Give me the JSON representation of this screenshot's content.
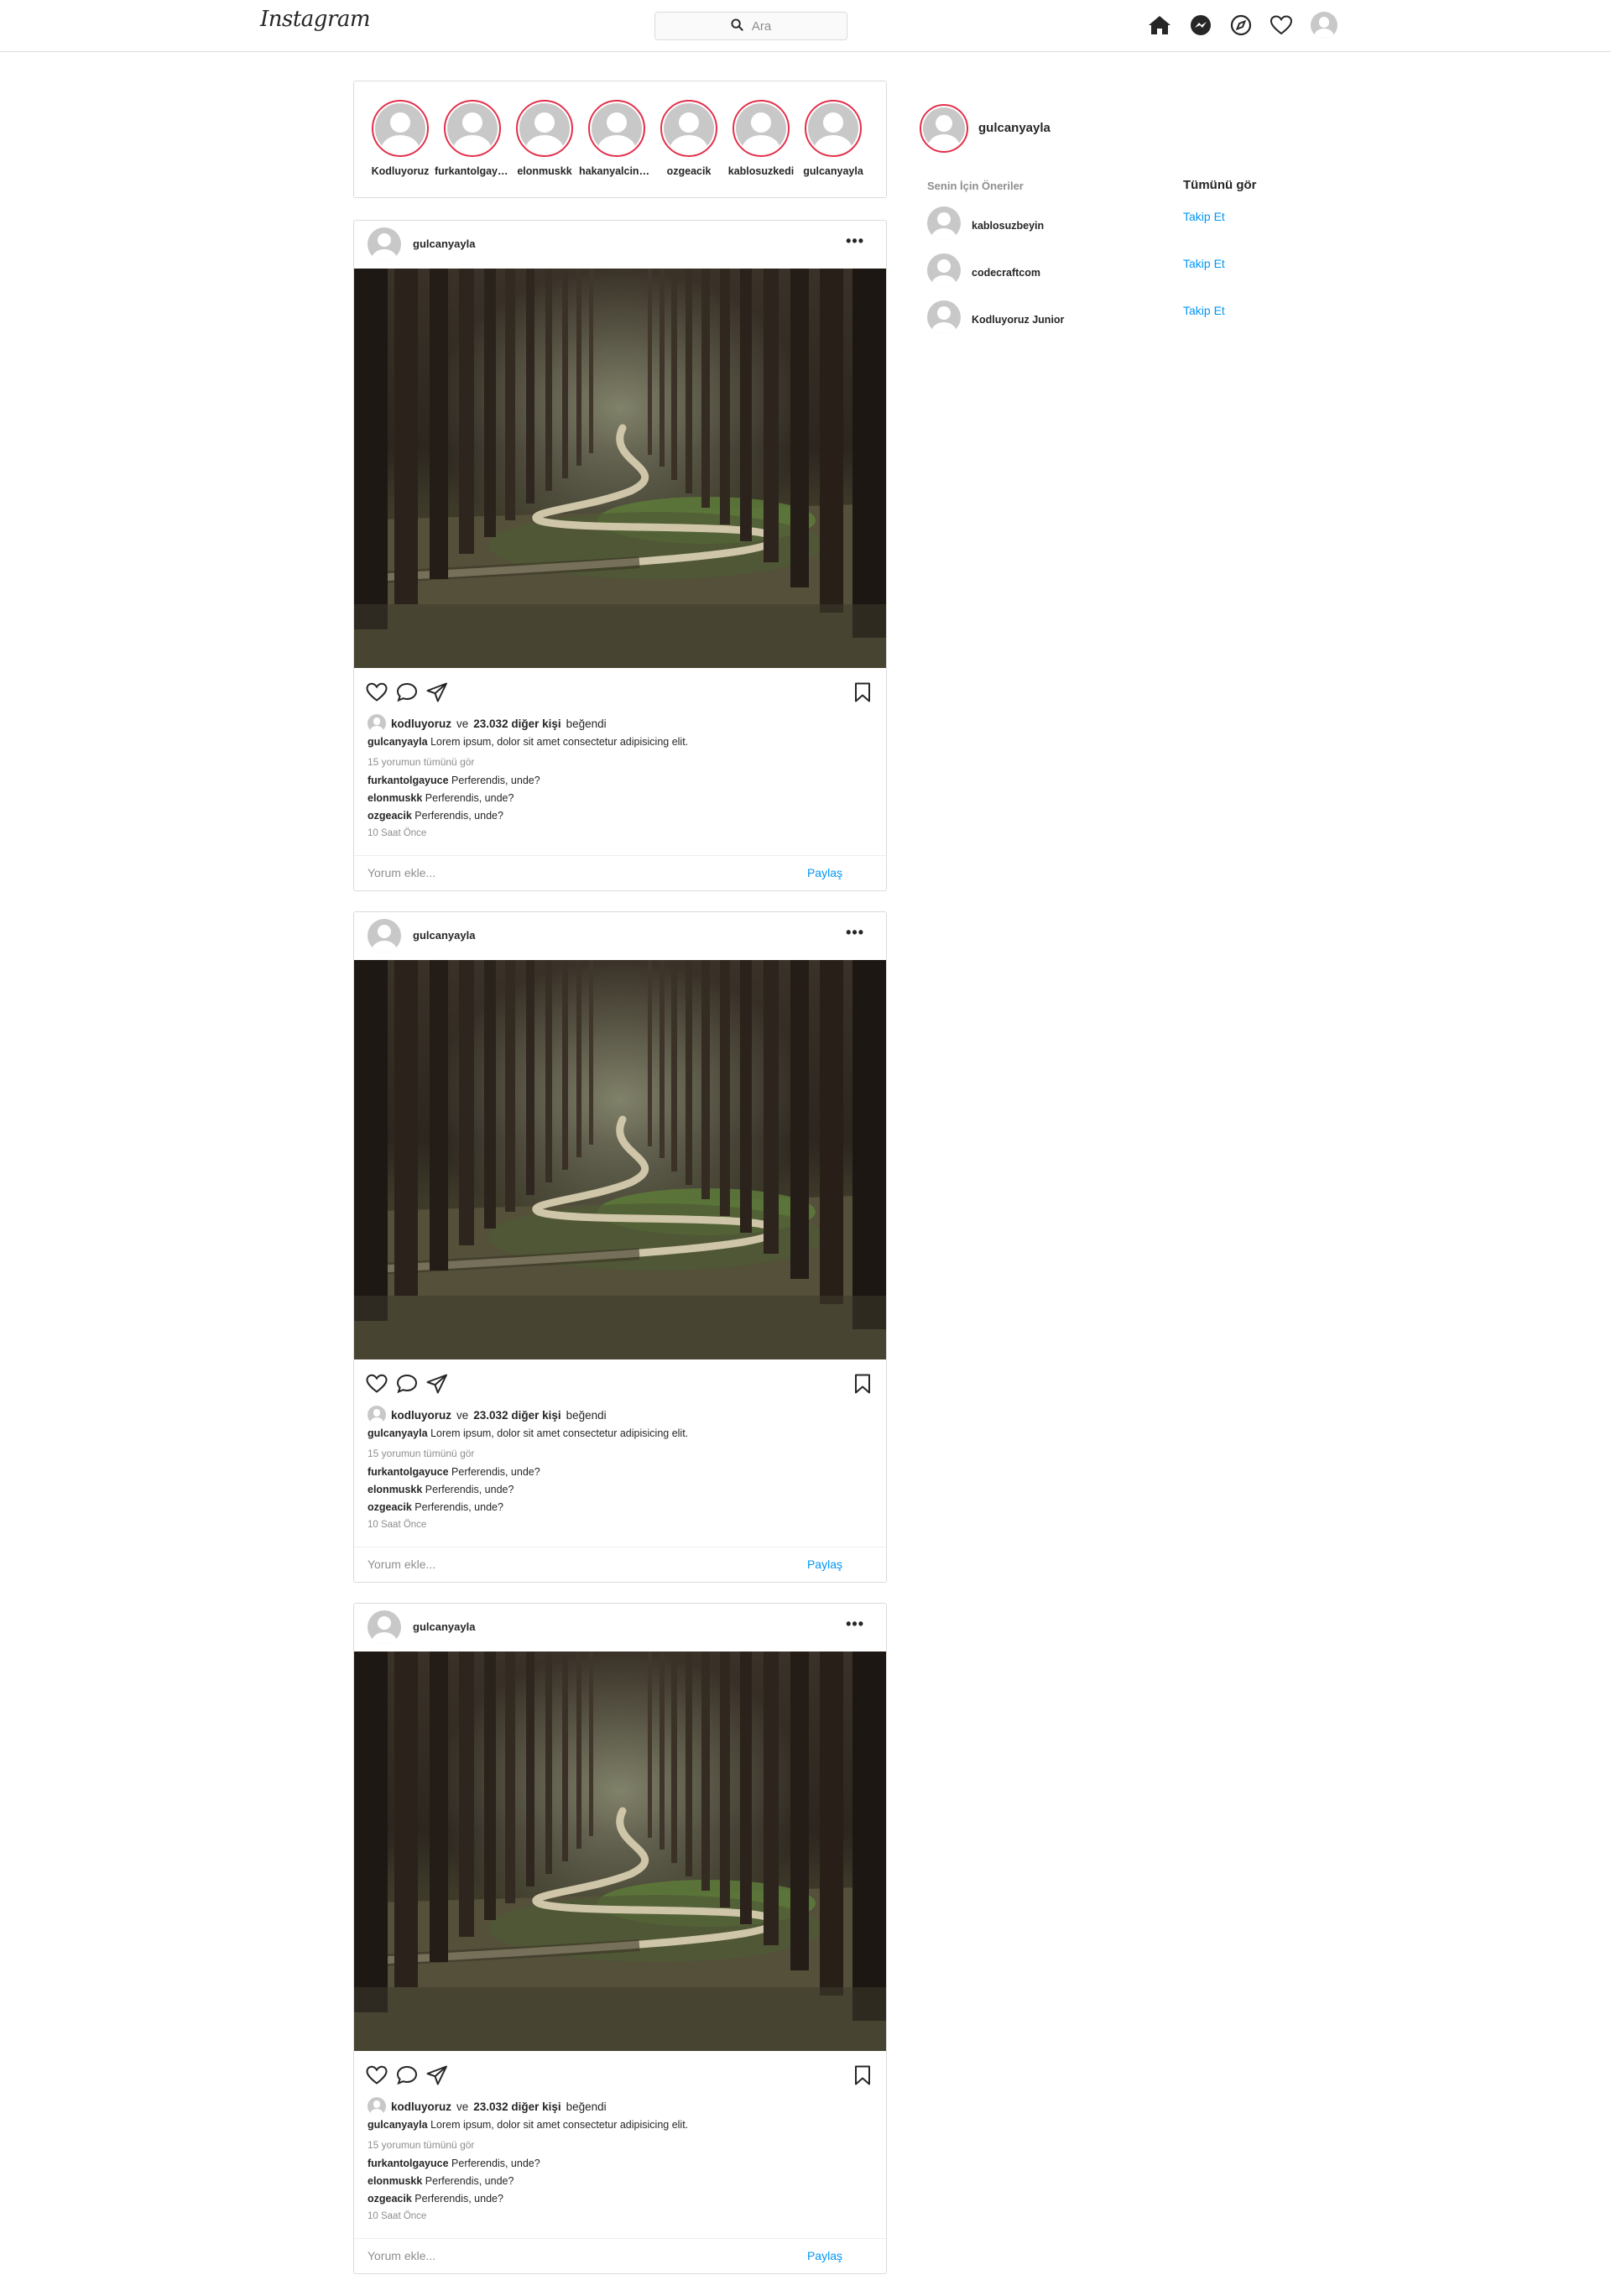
{
  "nav": {
    "logo": "Instagram",
    "search_placeholder": "Ara"
  },
  "stories": [
    {
      "name": "Kodluyoruz"
    },
    {
      "name": "furkantolgayuce"
    },
    {
      "name": "elonmuskk"
    },
    {
      "name": "hakanyalcinkaya"
    },
    {
      "name": "ozgeacik"
    },
    {
      "name": "kablosuzkedi"
    },
    {
      "name": "gulcanyayla"
    }
  ],
  "post": {
    "author": "gulcanyayla",
    "more": "•••",
    "liker": "kodluyoruz",
    "likes_and": "ve",
    "likes_count": "23.032 diğer kişi",
    "likes_suffix": "beğendi",
    "caption_user": "gulcanyayla",
    "caption_text": "Lorem ipsum, dolor sit amet consectetur adipisicing elit.",
    "view_all": "15 yorumun tümünü gör",
    "comments": [
      {
        "user": "furkantolgayuce",
        "text": "Perferendis, unde?"
      },
      {
        "user": "elonmuskk",
        "text": "Perferendis, unde?"
      },
      {
        "user": "ozgeacik",
        "text": "Perferendis, unde?"
      }
    ],
    "time_ago": "10 Saat Önce",
    "comment_placeholder": "Yorum ekle...",
    "share_label": "Paylaş"
  },
  "sidebar": {
    "username": "gulcanyayla",
    "suggestions_title": "Senin İçin Öneriler",
    "see_all": "Tümünü gör",
    "suggestions": [
      {
        "name": "kablosuzbeyin",
        "action": "Takip Et"
      },
      {
        "name": "codecraftcom",
        "action": "Takip Et"
      },
      {
        "name": "Kodluyoruz Junior",
        "action": "Takip Et"
      }
    ]
  },
  "colors": {
    "story_ring": "#e3304b",
    "link_blue": "#0095f6",
    "border": "#dbdbdb"
  }
}
